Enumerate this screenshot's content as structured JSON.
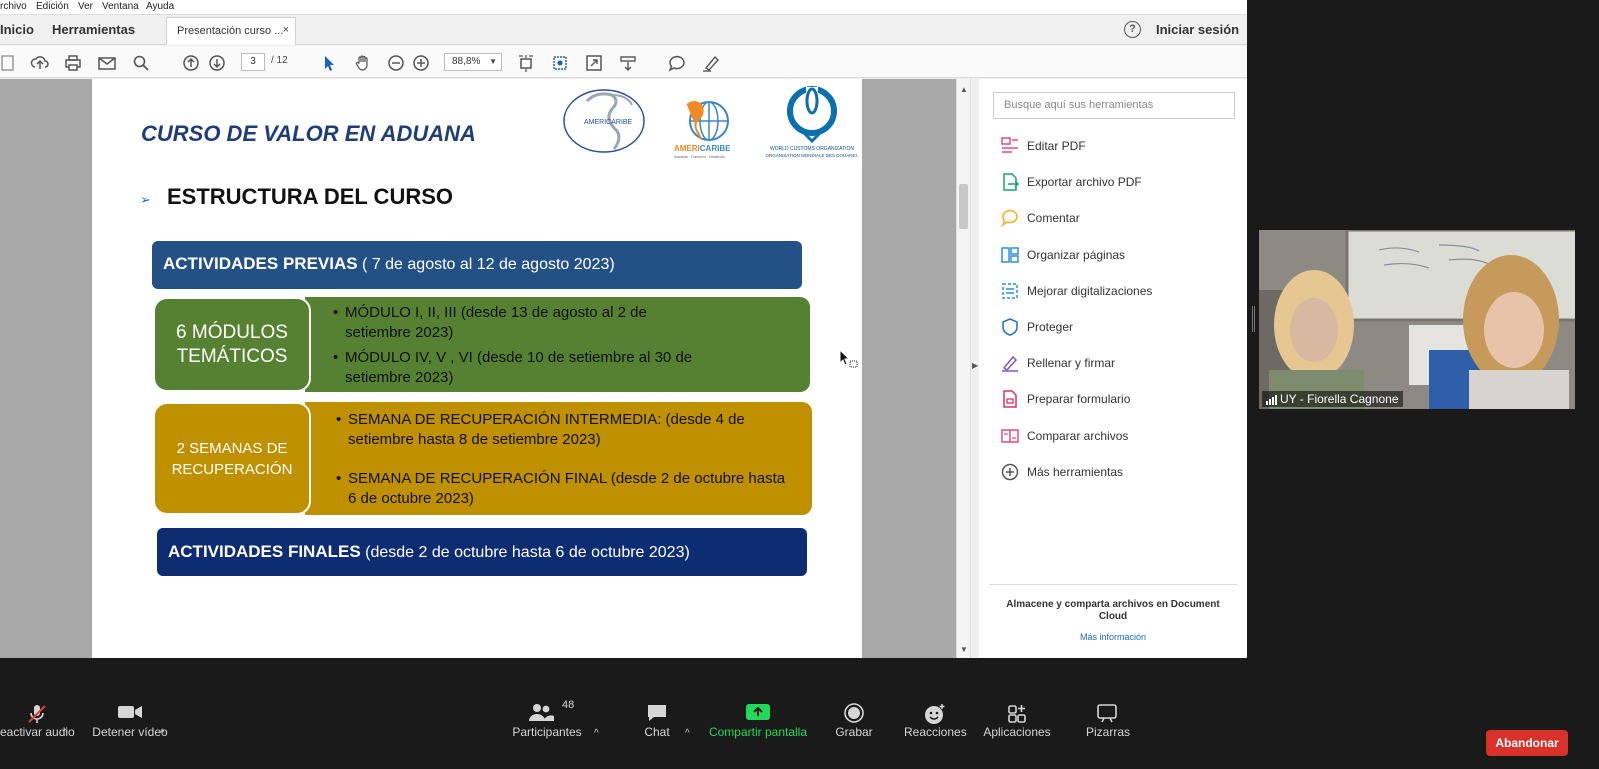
{
  "menubar": {
    "items": [
      "rchivo",
      "Edición",
      "Ver",
      "Ventana",
      "Ayuda"
    ]
  },
  "tabbar": {
    "home": "Inicio",
    "tools": "Herramientas",
    "doc_tab": "Presentación curso ...",
    "close": "×",
    "signin": "Iniciar sesión",
    "help": "?"
  },
  "toolbar": {
    "page_current": "3",
    "page_total": "/ 12",
    "zoom": "88,8%"
  },
  "slide": {
    "title": "CURSO DE VALOR EN ADUANA",
    "section_bullet": "➢",
    "section": "ESTRUCTURA DEL CURSO",
    "previas_bold": "ACTIVIDADES PREVIAS",
    "previas_rest": " ( 7 de agosto al 12 de agosto 2023)",
    "modulos_pill": "6 MÓDULOS TEMÁTICOS",
    "modulo_1": "MÓDULO I, II, III  (desde 13 de agosto al 2 de setiembre 2023)",
    "modulo_2": "MÓDULO IV, V , VI  (desde 10 de setiembre al 30 de setiembre 2023)",
    "semanas_pill": "2 SEMANAS DE RECUPERACIÓN",
    "semana_1": "SEMANA DE RECUPERACIÓN INTERMEDIA: (desde 4 de setiembre hasta 8 de setiembre 2023)",
    "semana_2": "SEMANA DE RECUPERACIÓN FINAL (desde 2 de octubre hasta 6 de octubre 2023)",
    "finales_bold": "ACTIVIDADES FINALES",
    "finales_rest": " (desde 2 de octubre hasta 6 de octubre 2023)",
    "logo_americaribe": "AMERICARIBE",
    "logo_americaribe_sub": "Aduanas · Comercio · Desarrollo",
    "logo_wco_1": "WORLD CUSTOMS ORGANIZATION",
    "logo_wco_2": "ORGANISATION MONDIALE DES DOUANES"
  },
  "tools_panel": {
    "search_placeholder": "Busque aquí sus herramientas",
    "items": [
      {
        "label": "Editar PDF",
        "icon": "edit-pdf-icon",
        "color": "#e34b87"
      },
      {
        "label": "Exportar archivo PDF",
        "icon": "export-pdf-icon",
        "color": "#17a56b"
      },
      {
        "label": "Comentar",
        "icon": "comment-icon",
        "color": "#f0b429"
      },
      {
        "label": "Organizar páginas",
        "icon": "organize-pages-icon",
        "color": "#2e8fd6"
      },
      {
        "label": "Mejorar digitalizaciones",
        "icon": "scan-icon",
        "color": "#2e8fd6"
      },
      {
        "label": "Proteger",
        "icon": "shield-icon",
        "color": "#2e6fd6"
      },
      {
        "label": "Rellenar y firmar",
        "icon": "fill-sign-icon",
        "color": "#7a57c8"
      },
      {
        "label": "Preparar formulario",
        "icon": "form-icon",
        "color": "#d6336c"
      },
      {
        "label": "Comparar archivos",
        "icon": "compare-icon",
        "color": "#e34b87"
      },
      {
        "label": "Más herramientas",
        "icon": "plus-circle-icon",
        "color": "#555555"
      }
    ],
    "cloud_title": "Almacene y comparta archivos en Document Cloud",
    "cloud_link": "Más información"
  },
  "video": {
    "name": "UY - Fiorella Cagnone"
  },
  "zoom_controls": {
    "audio": "eactivar audio",
    "video": "Detener vídeo",
    "participants": "Participantes",
    "participants_count": "48",
    "chat": "Chat",
    "share": "Compartir pantalla",
    "record": "Grabar",
    "reactions": "Reacciones",
    "apps": "Aplicaciones",
    "whiteboards": "Pizarras",
    "leave": "Abandonar",
    "caret": "^"
  },
  "colors": {
    "share_green": "#23d959",
    "leave_red": "#d8322b",
    "slide_blue": "#245185",
    "slide_navy": "#0d2c72",
    "slide_green": "#568133",
    "slide_gold": "#bf9000"
  }
}
